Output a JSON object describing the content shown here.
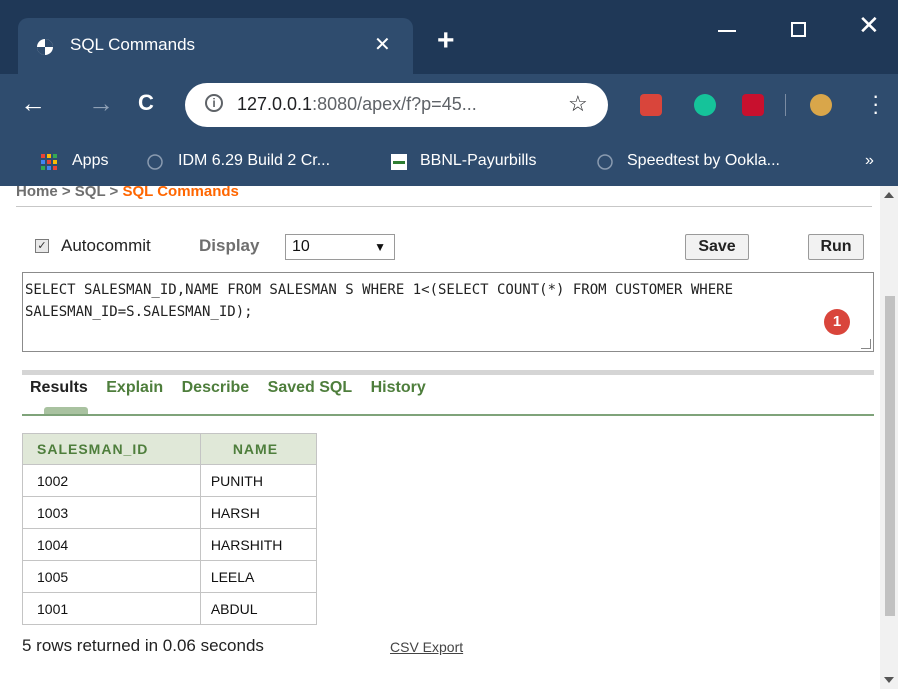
{
  "browser": {
    "tab_title": "SQL Commands",
    "tab_close": "✕",
    "new_tab": "+",
    "url_host": "127.0.0.1",
    "url_rest": ":8080/apex/f?p=45...",
    "info_symbol": "i",
    "back": "←",
    "forward": "→",
    "reload": "C",
    "star": "☆",
    "bookmarks": [
      {
        "label": "Apps",
        "icon": "apps-grid-icon"
      },
      {
        "label": "IDM 6.29 Build 2 Cr...",
        "icon": "globe-icon"
      },
      {
        "label": "BBNL-Payurbills",
        "icon": "bbnl-icon"
      },
      {
        "label": "Speedtest by Ookla...",
        "icon": "globe-icon"
      }
    ],
    "bookmarks_more": "»",
    "colors": {
      "frame": "#1f3857",
      "toolbar": "#2f4c6e"
    }
  },
  "page": {
    "breadcrumb": {
      "home": "Home",
      "sql": "SQL",
      "current": "SQL Commands",
      "sep": " > "
    },
    "autocommit_label": "Autocommit",
    "display_label": "Display",
    "display_value": "10",
    "save_label": "Save",
    "run_label": "Run",
    "sql_text": "SELECT SALESMAN_ID,NAME FROM SALESMAN S WHERE 1<(SELECT COUNT(*) FROM CUSTOMER WHERE SALESMAN_ID=S.SALESMAN_ID);",
    "badge_count": "1",
    "tabs": [
      "Results",
      "Explain",
      "Describe",
      "Saved SQL",
      "History"
    ],
    "results": {
      "columns": [
        "SALESMAN_ID",
        "NAME"
      ],
      "rows": [
        [
          "1002",
          "PUNITH"
        ],
        [
          "1003",
          "HARSH"
        ],
        [
          "1004",
          "HARSHITH"
        ],
        [
          "1005",
          "LEELA"
        ],
        [
          "1001",
          "ABDUL"
        ]
      ]
    },
    "status": "5 rows returned in 0.06 seconds",
    "csv_export": "CSV Export",
    "accent_orange": "#ff6600",
    "accent_green": "#4e7e3c"
  }
}
